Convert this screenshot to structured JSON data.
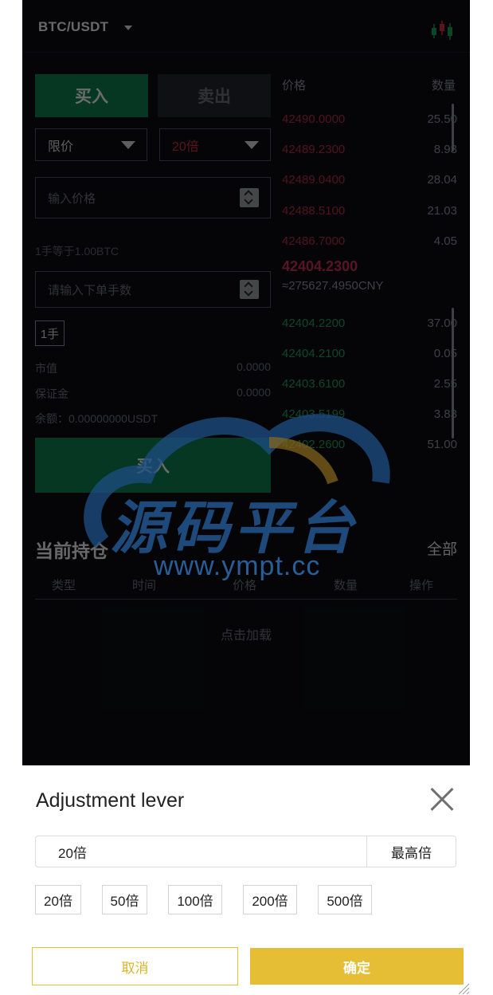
{
  "header": {
    "pair": "BTC/USDT",
    "chart_icon": "candlestick-icon"
  },
  "trade": {
    "buy_tab": "买入",
    "sell_tab": "卖出",
    "order_type": "限价",
    "leverage": "20倍",
    "price_placeholder": "输入价格",
    "lot_note": "1手等于1.00BTC",
    "qty_placeholder": "请输入下单手数",
    "lot_chip": "1手",
    "market_value_label": "市值",
    "market_value": "0.0000",
    "margin_label": "保证金",
    "margin": "0.0000",
    "balance": "余额：0.00000000USDT",
    "submit": "买入"
  },
  "orderbook": {
    "price_header": "价格",
    "qty_header": "数量",
    "asks": [
      {
        "price": "42490.0000",
        "qty": "25.50"
      },
      {
        "price": "42489.2300",
        "qty": "8.93"
      },
      {
        "price": "42489.0400",
        "qty": "28.04"
      },
      {
        "price": "42488.5100",
        "qty": "21.03"
      },
      {
        "price": "42486.7000",
        "qty": "4.05"
      }
    ],
    "last_price": "42404.2300",
    "last_cny": "≈275627.4950CNY",
    "bids": [
      {
        "price": "42404.2200",
        "qty": "37.00"
      },
      {
        "price": "42404.2100",
        "qty": "0.05"
      },
      {
        "price": "42403.6100",
        "qty": "2.55"
      },
      {
        "price": "42403.5199",
        "qty": "3.83"
      },
      {
        "price": "42402.2600",
        "qty": "51.00"
      }
    ]
  },
  "positions": {
    "title": "当前持仓",
    "all_link": "全部",
    "columns": [
      "类型",
      "时间",
      "价格",
      "数量",
      "操作"
    ],
    "load_more": "点击加载"
  },
  "watermark": {
    "text": "源码平台",
    "url": "www.ympt.cc"
  },
  "lever_sheet": {
    "title": "Adjustment lever",
    "current_value": "20倍",
    "max_label": "最高倍",
    "options": [
      "20倍",
      "50倍",
      "100倍",
      "200倍",
      "500倍"
    ],
    "cancel": "取消",
    "confirm": "确定"
  },
  "colors": {
    "buy_green": "#0f7a4d",
    "ask_red": "#b02a45",
    "bid_green": "#1c9a60",
    "confirm_gold": "#e5be35"
  }
}
